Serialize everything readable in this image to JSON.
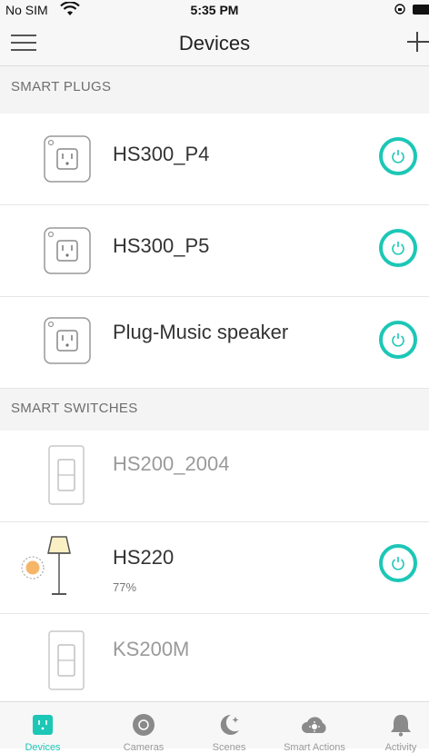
{
  "status_bar": {
    "carrier": "No SIM",
    "time": "5:35 PM"
  },
  "nav": {
    "title": "Devices"
  },
  "sections": {
    "plugs": "SMART PLUGS",
    "switches": "SMART SWITCHES"
  },
  "plugs": [
    {
      "name": "HS300_P4",
      "state": "on"
    },
    {
      "name": "HS300_P5",
      "state": "on"
    },
    {
      "name": "Plug-Music speaker",
      "state": "on"
    }
  ],
  "switches": [
    {
      "name": "HS200_2004",
      "state": "offline"
    },
    {
      "name": "HS220",
      "brightness": "77%",
      "state": "on"
    },
    {
      "name": "KS200M",
      "state": "offline"
    }
  ],
  "tabs": [
    {
      "label": "Devices",
      "icon": "plug-icon",
      "active": true
    },
    {
      "label": "Cameras",
      "icon": "camera-icon",
      "active": false
    },
    {
      "label": "Scenes",
      "icon": "scenes-icon",
      "active": false
    },
    {
      "label": "Smart Actions",
      "icon": "smart-actions-icon",
      "active": false
    },
    {
      "label": "Activity",
      "icon": "bell-icon",
      "active": false
    }
  ],
  "colors": {
    "accent": "#1cc7b6",
    "section_bg": "#f4f4f4",
    "bar_bg": "#f7f7f7"
  }
}
